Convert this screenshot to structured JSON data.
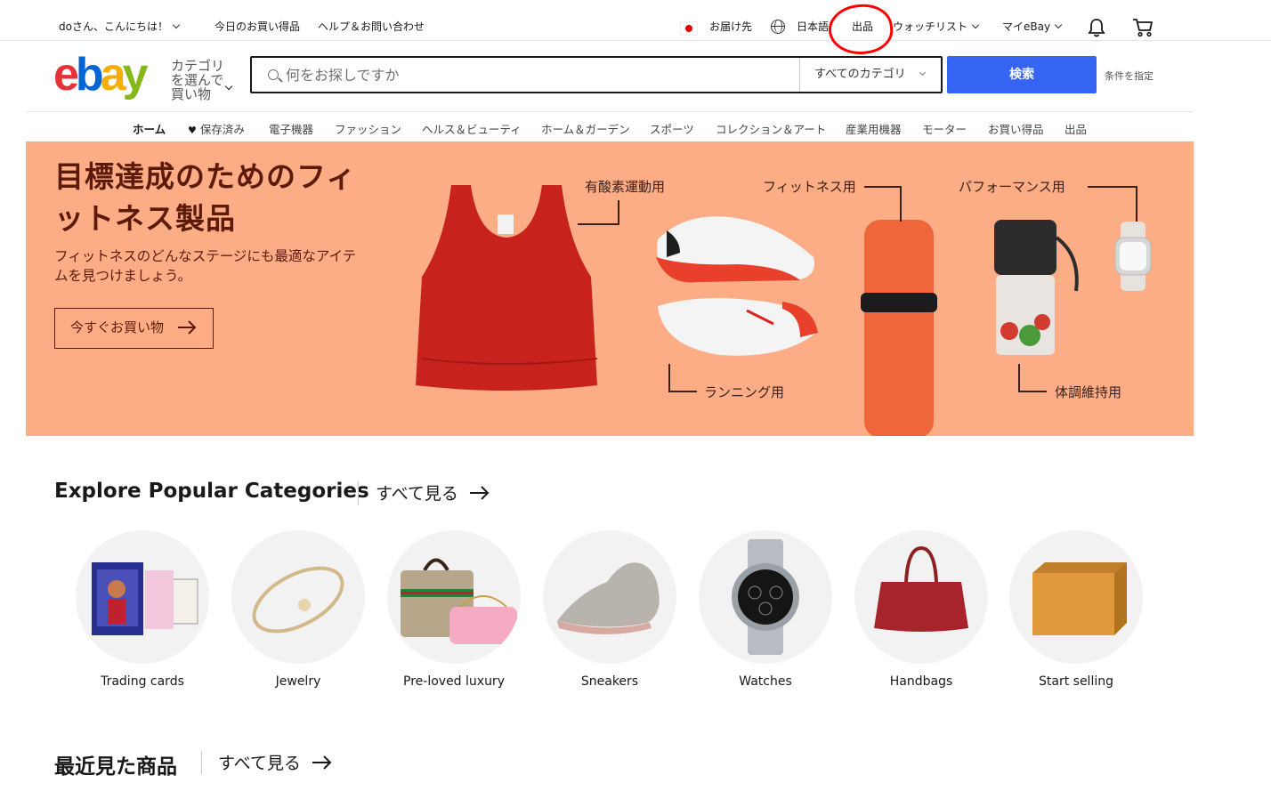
{
  "topbar": {
    "greeting": "doさん、こんにちは！",
    "daily_deals": "今日のお買い得品",
    "help": "ヘルプ＆お問い合わせ",
    "ship_to": "お届け先",
    "language": "日本語",
    "sell": "出品",
    "watchlist": "ウォッチリスト",
    "my_ebay": "マイeBay"
  },
  "header": {
    "shop_by_category": "カテゴリを選んで買い物",
    "search_placeholder": "何をお探しですか",
    "category_select": "すべてのカテゴリ",
    "search_button": "検索",
    "advanced": "条件を指定"
  },
  "nav": {
    "items": [
      "ホーム",
      "保存済み",
      "電子機器",
      "ファッション",
      "ヘルス＆ビューティ",
      "ホーム＆ガーデン",
      "スポーツ",
      "コレクション＆アート",
      "産業用機器",
      "モーター",
      "お買い得品",
      "出品"
    ]
  },
  "hero": {
    "title": "目標達成のためのフィットネス製品",
    "subtitle": "フィットネスのどんなステージにも最適なアイテムを見つけましょう。",
    "cta": "今すぐお買い物",
    "labels": {
      "aerobic": "有酸素運動用",
      "fitness": "フィットネス用",
      "performance": "パフォーマンス用",
      "running": "ランニング用",
      "health": "体調維持用"
    }
  },
  "categories": {
    "title": "Explore Popular Categories",
    "see_all": "すべて見る",
    "items": [
      "Trading cards",
      "Jewelry",
      "Pre-loved luxury",
      "Sneakers",
      "Watches",
      "Handbags",
      "Start selling"
    ]
  },
  "recent": {
    "title": "最近見た商品",
    "see_all": "すべて見る"
  },
  "colors": {
    "hero_bg": "#fdad86",
    "search_button": "#3665f3",
    "annotation": "#ff0000"
  }
}
